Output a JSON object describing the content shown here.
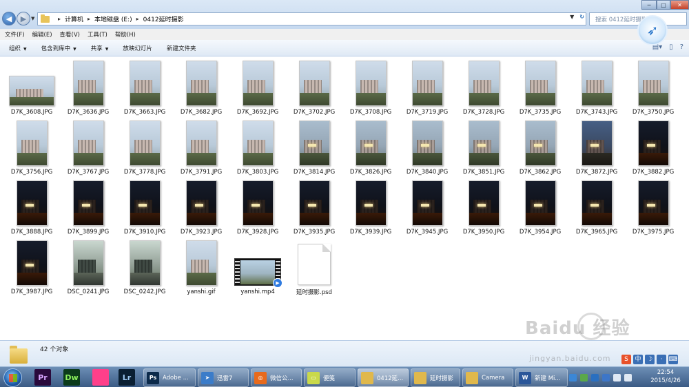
{
  "address_bar": {
    "crumbs": [
      "计算机",
      "本地磁盘 (E:)",
      "0412延时摄影"
    ],
    "search_placeholder": "搜索 0412延时摄影"
  },
  "menu": [
    "文件(F)",
    "编辑(E)",
    "查看(V)",
    "工具(T)",
    "帮助(H)"
  ],
  "toolbar": {
    "organize": "组织",
    "include_in_library": "包含到库中",
    "share": "共享",
    "slideshow": "放映幻灯片",
    "new_folder": "新建文件夹"
  },
  "files": [
    {
      "name": "D7K_3608.JPG",
      "kind": "landscape",
      "tone": "day"
    },
    {
      "name": "D7K_3636.JPG",
      "kind": "portrait",
      "tone": "day"
    },
    {
      "name": "D7K_3663.JPG",
      "kind": "portrait",
      "tone": "day"
    },
    {
      "name": "D7K_3682.JPG",
      "kind": "portrait",
      "tone": "day"
    },
    {
      "name": "D7K_3692.JPG",
      "kind": "portrait",
      "tone": "day"
    },
    {
      "name": "D7K_3702.JPG",
      "kind": "portrait",
      "tone": "day"
    },
    {
      "name": "D7K_3708.JPG",
      "kind": "portrait",
      "tone": "day"
    },
    {
      "name": "D7K_3719.JPG",
      "kind": "portrait",
      "tone": "day"
    },
    {
      "name": "D7K_3728.JPG",
      "kind": "portrait",
      "tone": "day"
    },
    {
      "name": "D7K_3735.JPG",
      "kind": "portrait",
      "tone": "day"
    },
    {
      "name": "D7K_3743.JPG",
      "kind": "portrait",
      "tone": "day"
    },
    {
      "name": "D7K_3750.JPG",
      "kind": "portrait",
      "tone": "day"
    },
    {
      "name": "D7K_3756.JPG",
      "kind": "portrait",
      "tone": "day"
    },
    {
      "name": "D7K_3767.JPG",
      "kind": "portrait",
      "tone": "day"
    },
    {
      "name": "D7K_3778.JPG",
      "kind": "portrait",
      "tone": "day"
    },
    {
      "name": "D7K_3791.JPG",
      "kind": "portrait",
      "tone": "day"
    },
    {
      "name": "D7K_3803.JPG",
      "kind": "portrait",
      "tone": "day"
    },
    {
      "name": "D7K_3814.JPG",
      "kind": "portrait",
      "tone": "dusk"
    },
    {
      "name": "D7K_3826.JPG",
      "kind": "portrait",
      "tone": "dusk"
    },
    {
      "name": "D7K_3840.JPG",
      "kind": "portrait",
      "tone": "dusk"
    },
    {
      "name": "D7K_3851.JPG",
      "kind": "portrait",
      "tone": "dusk"
    },
    {
      "name": "D7K_3862.JPG",
      "kind": "portrait",
      "tone": "dusk"
    },
    {
      "name": "D7K_3872.JPG",
      "kind": "portrait",
      "tone": "evening"
    },
    {
      "name": "D7K_3882.JPG",
      "kind": "portrait",
      "tone": "night"
    },
    {
      "name": "D7K_3888.JPG",
      "kind": "portrait",
      "tone": "night"
    },
    {
      "name": "D7K_3899.JPG",
      "kind": "portrait",
      "tone": "night"
    },
    {
      "name": "D7K_3910.JPG",
      "kind": "portrait",
      "tone": "night"
    },
    {
      "name": "D7K_3923.JPG",
      "kind": "portrait",
      "tone": "night"
    },
    {
      "name": "D7K_3928.JPG",
      "kind": "portrait",
      "tone": "night"
    },
    {
      "name": "D7K_3935.JPG",
      "kind": "portrait",
      "tone": "night"
    },
    {
      "name": "D7K_3939.JPG",
      "kind": "portrait",
      "tone": "night"
    },
    {
      "name": "D7K_3945.JPG",
      "kind": "portrait",
      "tone": "night"
    },
    {
      "name": "D7K_3950.JPG",
      "kind": "portrait",
      "tone": "night"
    },
    {
      "name": "D7K_3954.JPG",
      "kind": "portrait",
      "tone": "night"
    },
    {
      "name": "D7K_3965.JPG",
      "kind": "portrait",
      "tone": "night"
    },
    {
      "name": "D7K_3975.JPG",
      "kind": "portrait",
      "tone": "night"
    },
    {
      "name": "D7K_3987.JPG",
      "kind": "portrait",
      "tone": "night"
    },
    {
      "name": "DSC_0241.JPG",
      "kind": "portrait",
      "tone": "tripod"
    },
    {
      "name": "DSC_0242.JPG",
      "kind": "portrait",
      "tone": "tripod"
    },
    {
      "name": "yanshi.gif",
      "kind": "portrait",
      "tone": "day"
    },
    {
      "name": "yanshi.mp4",
      "kind": "video",
      "tone": "day"
    },
    {
      "name": "延时摄影.psd",
      "kind": "doc",
      "tone": "none"
    }
  ],
  "status": {
    "count_text": "42 个对象"
  },
  "watermark": {
    "brand": "Baidu 经验",
    "url": "jingyan.baidu.com"
  },
  "taskbar": {
    "pinned": [
      {
        "icon": "premiere-icon",
        "text": "Pr",
        "color": "#2a0a3c",
        "fg": "#d9a6ff"
      },
      {
        "icon": "dreamweaver-icon",
        "text": "Dw",
        "color": "#0b3b1a",
        "fg": "#8cf25d"
      },
      {
        "icon": "colorful-app-icon",
        "text": "",
        "color": "#ff3f8a",
        "fg": "#fff"
      },
      {
        "icon": "lightroom-icon",
        "text": "Lr",
        "color": "#0a1f33",
        "fg": "#9cc7f0"
      }
    ],
    "tasks": [
      {
        "label": "Adobe ...",
        "icon_text": "Ps",
        "icon_color": "#0c2a4a"
      },
      {
        "label": "迅雷7",
        "icon_text": "➤",
        "icon_color": "#3b7cc9"
      },
      {
        "label": "微信公...",
        "icon_text": "◎",
        "icon_color": "#e86a1c"
      },
      {
        "label": "便笺",
        "icon_text": "▭",
        "icon_color": "#c9d94a"
      },
      {
        "label": "0412延...",
        "icon_text": "",
        "icon_color": "#e0b84c"
      },
      {
        "label": "延时摄影",
        "icon_text": "",
        "icon_color": "#e0b84c"
      },
      {
        "label": "Camera",
        "icon_text": "",
        "icon_color": "#e0b84c"
      },
      {
        "label": "新建 Mi...",
        "icon_text": "W",
        "icon_color": "#2b579a"
      }
    ],
    "time": "22:54",
    "date": "2015/4/26"
  }
}
